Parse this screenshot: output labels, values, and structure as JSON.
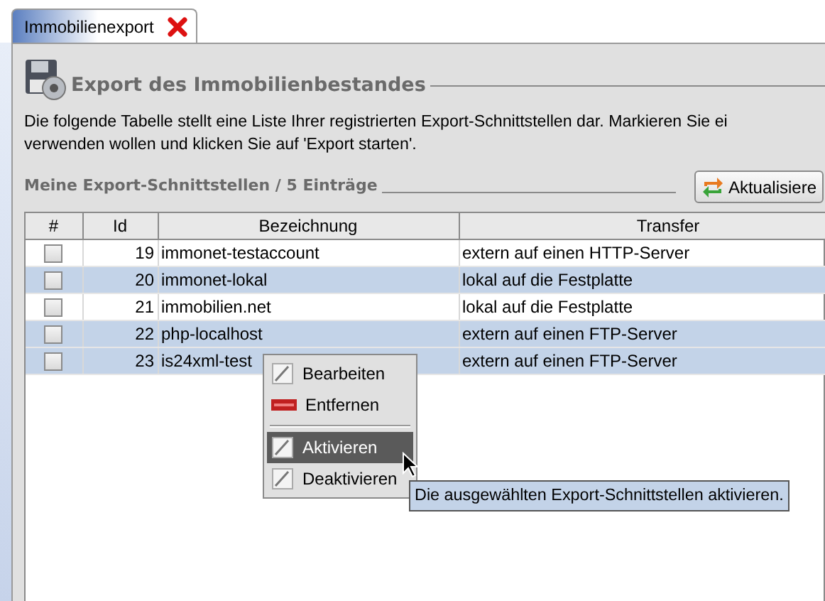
{
  "tabs": [
    {
      "label": "Immobilienexport",
      "selected": true
    }
  ],
  "heading": "Export des Immobilienbestandes",
  "description": [
    "Die folgende Tabelle stellt eine Liste Ihrer registrierten Export-Schnittstellen dar. Markieren Sie ei",
    "verwenden wollen und klicken Sie auf 'Export starten'."
  ],
  "section_title": "Meine Export-Schnittstellen / 5 Einträge",
  "refresh_button": "Aktualisiere",
  "table": {
    "columns": [
      "#",
      "Id",
      "Bezeichnung",
      "Transfer"
    ],
    "rows": [
      {
        "checked": false,
        "selected": false,
        "id": "19",
        "name": "immonet-testaccount",
        "transfer": "extern auf einen HTTP-Server"
      },
      {
        "checked": false,
        "selected": true,
        "id": "20",
        "name": "immonet-lokal",
        "transfer": "lokal auf die Festplatte"
      },
      {
        "checked": false,
        "selected": false,
        "id": "21",
        "name": "immobilien.net",
        "transfer": "lokal auf die Festplatte"
      },
      {
        "checked": false,
        "selected": true,
        "id": "22",
        "name": "php-localhost",
        "transfer": "extern auf einen FTP-Server"
      },
      {
        "checked": false,
        "selected": true,
        "id": "23",
        "name": "is24xml-test",
        "transfer": "extern auf einen FTP-Server"
      }
    ]
  },
  "context_menu": [
    {
      "kind": "edit",
      "label": "Bearbeiten",
      "selected": false
    },
    {
      "kind": "remove",
      "label": "Entfernen",
      "selected": false
    },
    {
      "kind": "separator"
    },
    {
      "kind": "edit",
      "label": "Aktivieren",
      "selected": true
    },
    {
      "kind": "edit",
      "label": "Deaktivieren",
      "selected": false
    }
  ],
  "tooltip": "Die ausgewählten Export-Schnittstellen aktivieren."
}
